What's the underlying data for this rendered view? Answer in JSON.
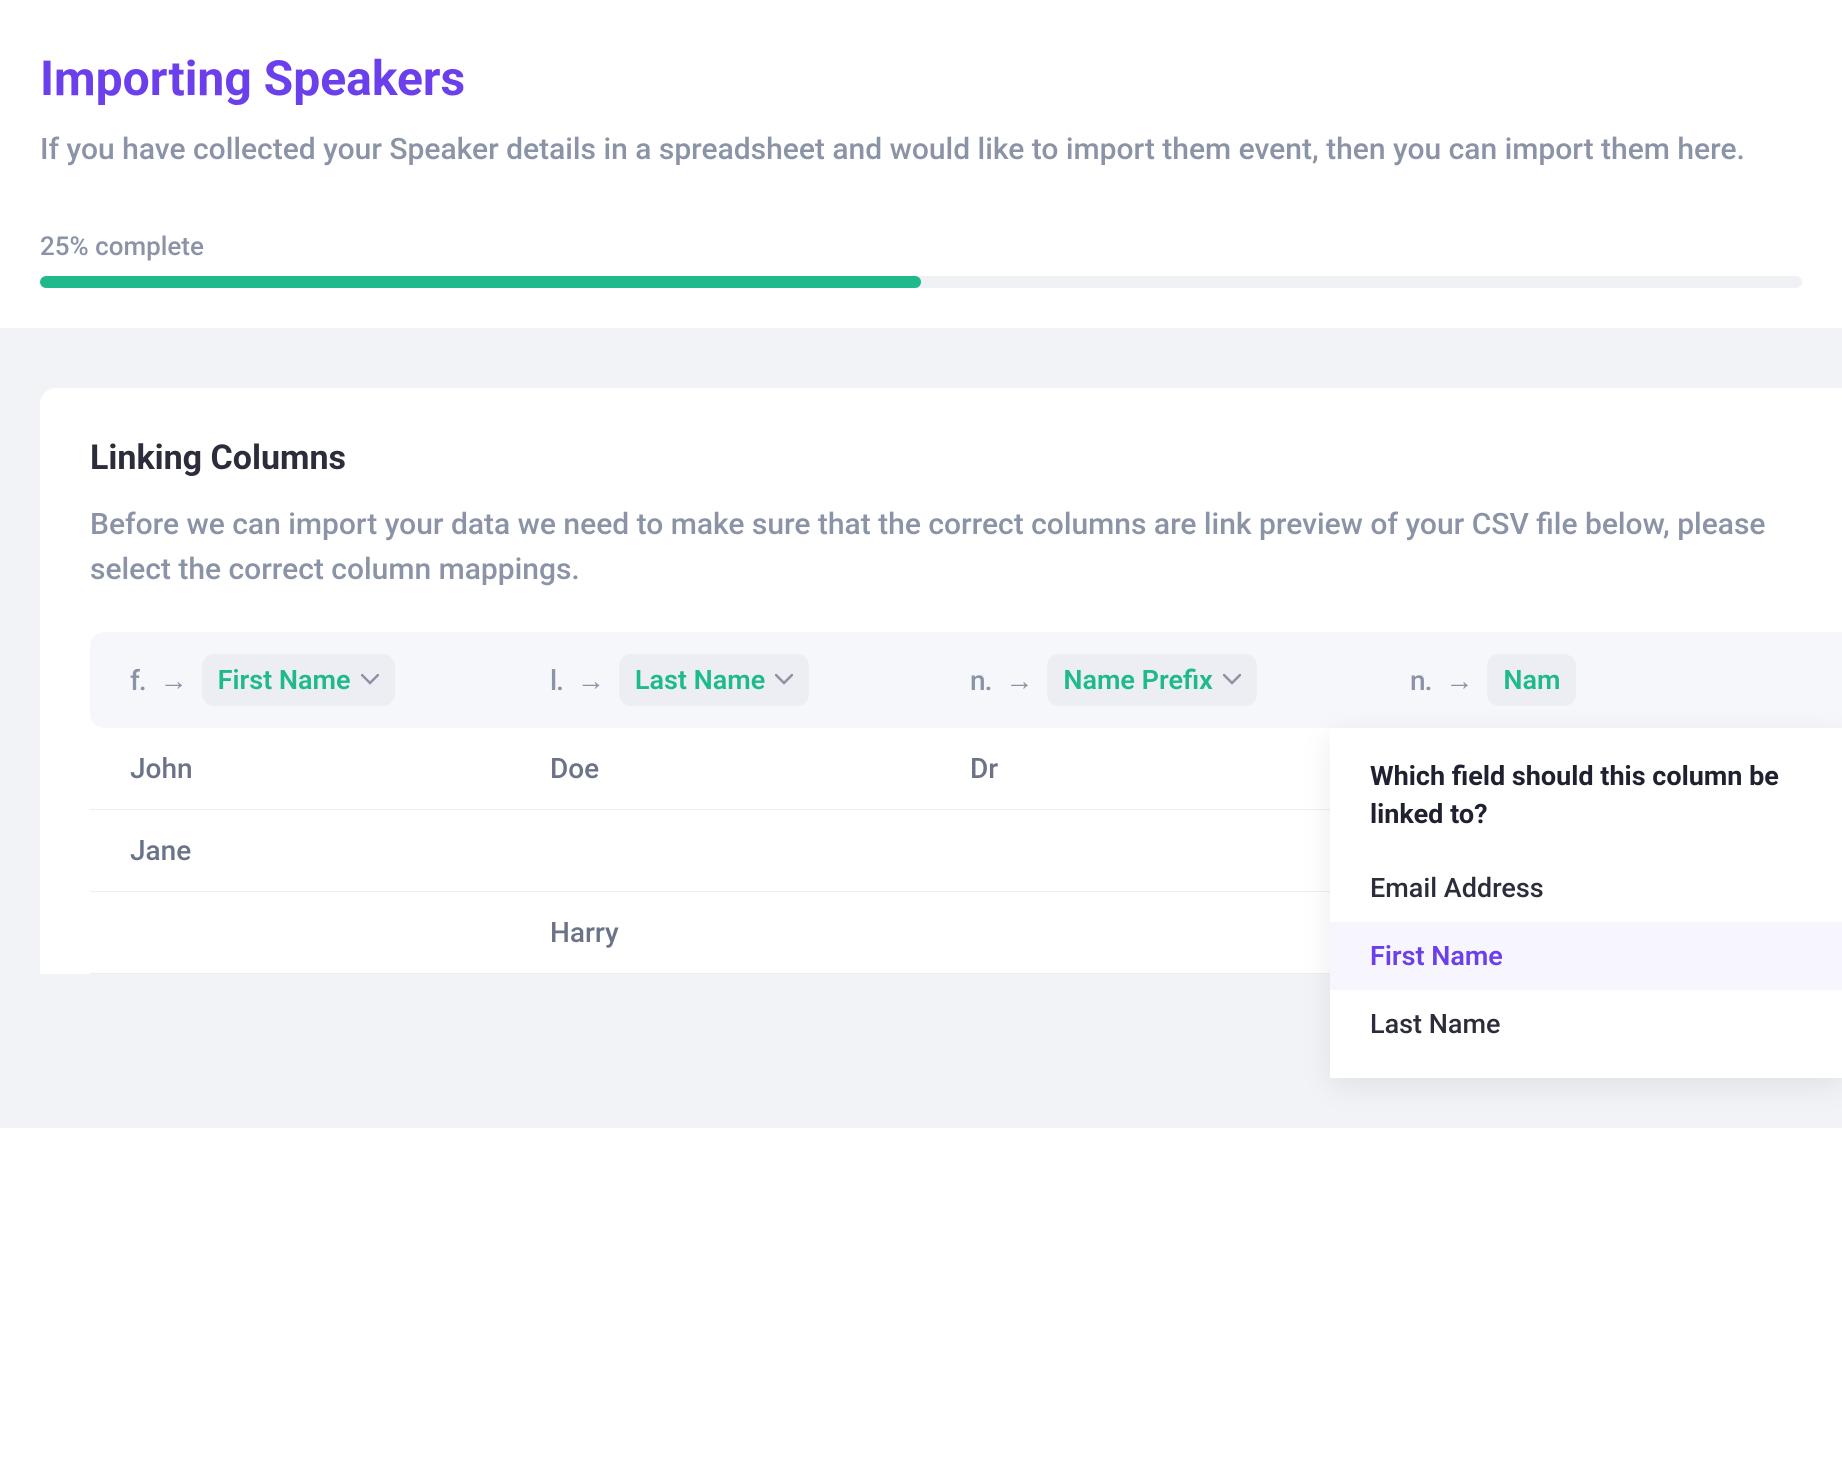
{
  "header": {
    "title": "Importing Speakers",
    "subtitle": "If you have collected your Speaker details in a spreadsheet and would like to import them event, then you can import them here."
  },
  "progress": {
    "label": "25% complete",
    "percent": 50
  },
  "card": {
    "title": "Linking Columns",
    "description": "Before we can import your data we need to make sure that the correct columns are link preview of your CSV file below, please select the correct column mappings."
  },
  "columns": [
    {
      "source": "f.",
      "mapped": "First Name"
    },
    {
      "source": "l.",
      "mapped": "Last Name"
    },
    {
      "source": "n.",
      "mapped": "Name Prefix"
    },
    {
      "source": "n.",
      "mapped": "Nam"
    }
  ],
  "rows": [
    {
      "c1": "John",
      "c2": "Doe",
      "c3": "Dr",
      "c4": ""
    },
    {
      "c1": "Jane",
      "c2": "",
      "c3": "",
      "c4": ""
    },
    {
      "c1": "",
      "c2": "Harry",
      "c3": "",
      "c4": ""
    }
  ],
  "dropdown": {
    "title": "Which field should this column be linked to?",
    "options": [
      {
        "label": "Email Address",
        "selected": false
      },
      {
        "label": "First Name",
        "selected": true
      },
      {
        "label": "Last Name",
        "selected": false
      }
    ]
  }
}
